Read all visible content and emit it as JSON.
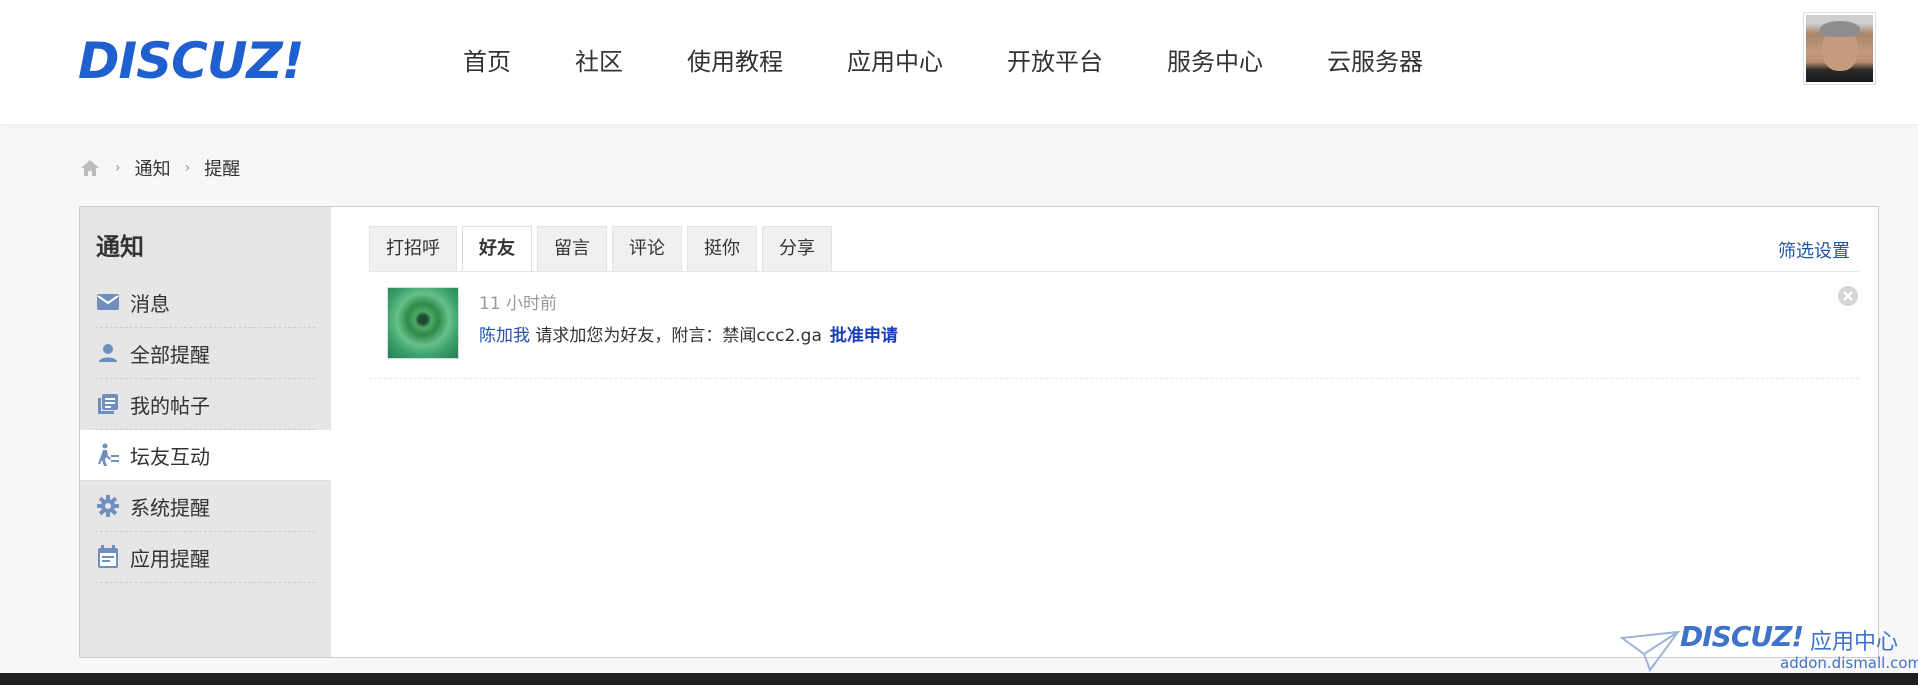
{
  "header": {
    "logo": "DISCUZ!",
    "nav": [
      "首页",
      "社区",
      "使用教程",
      "应用中心",
      "开放平台",
      "服务中心",
      "云服务器"
    ]
  },
  "breadcrumb": {
    "items": [
      "通知",
      "提醒"
    ],
    "home_icon": "home-icon"
  },
  "sidebar": {
    "title": "通知",
    "items": [
      {
        "label": "消息",
        "icon": "mail-icon",
        "active": false
      },
      {
        "label": "全部提醒",
        "icon": "user-icon",
        "active": false
      },
      {
        "label": "我的帖子",
        "icon": "posts-icon",
        "active": false
      },
      {
        "label": "坛友互动",
        "icon": "interaction-icon",
        "active": true
      },
      {
        "label": "系统提醒",
        "icon": "gear-icon",
        "active": false
      },
      {
        "label": "应用提醒",
        "icon": "calendar-icon",
        "active": false
      }
    ]
  },
  "tabs": {
    "items": [
      "打招呼",
      "好友",
      "留言",
      "评论",
      "挺你",
      "分享"
    ],
    "active": "好友",
    "filter_label": "筛选设置"
  },
  "notices": [
    {
      "time": "11 小时前",
      "user": "陈加我",
      "message": " 请求加您为好友，附言：禁闻ccc2.ga",
      "action": "批准申请"
    }
  ],
  "watermark": {
    "logo": "DISCUZ!",
    "label": "应用中心",
    "url": "addon.dismall.com"
  },
  "colors": {
    "accent": "#1f5fd0",
    "link": "#2255aa",
    "sidebar_bg": "#e6e6e6",
    "footer": "#1f1f1f"
  }
}
